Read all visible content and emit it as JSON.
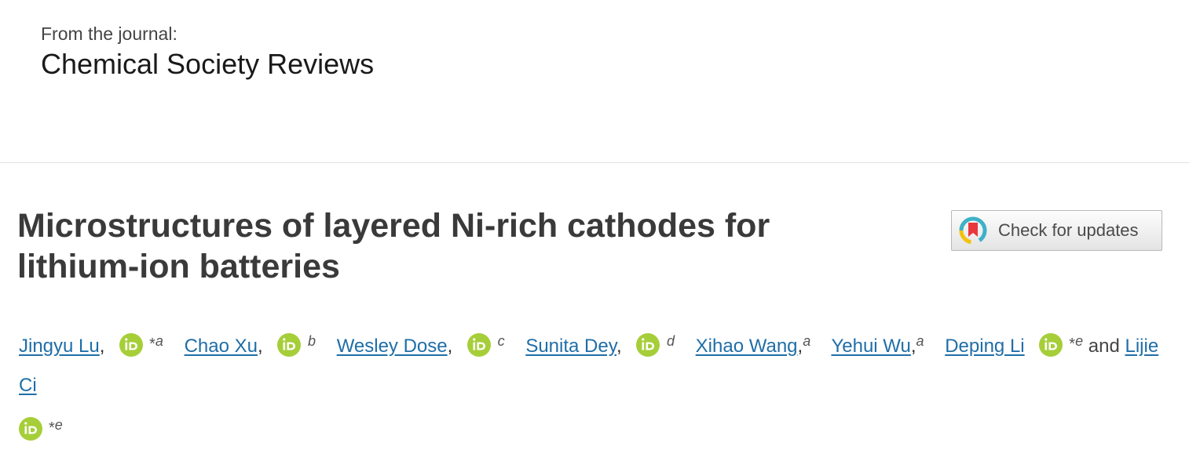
{
  "journal": {
    "prefix": "From the journal:",
    "name": "Chemical Society Reviews"
  },
  "article": {
    "title": "Microstructures of layered Ni-rich cathodes for lithium-ion batteries"
  },
  "check_updates": {
    "label": "Check for updates",
    "icon": "crossmark-icon"
  },
  "authors": {
    "and_word": "and",
    "list": [
      {
        "name": "Jingyu Lu",
        "corresponding": "*",
        "affiliation": "a"
      },
      {
        "name": "Chao Xu",
        "corresponding": "",
        "affiliation": "b"
      },
      {
        "name": "Wesley Dose",
        "corresponding": "",
        "affiliation": "c"
      },
      {
        "name": "Sunita Dey",
        "corresponding": "",
        "affiliation": "d"
      },
      {
        "name": "Xihao Wang",
        "corresponding": "",
        "affiliation": "a"
      },
      {
        "name": "Yehui Wu",
        "corresponding": "",
        "affiliation": "a"
      },
      {
        "name": "Deping Li",
        "corresponding": "*",
        "affiliation": "e"
      },
      {
        "name": "Lijie Ci",
        "corresponding": "*",
        "affiliation": "e"
      }
    ]
  },
  "colors": {
    "link": "#1f6ea8",
    "orcid": "#a6ce39",
    "title": "#3a3a3a"
  }
}
